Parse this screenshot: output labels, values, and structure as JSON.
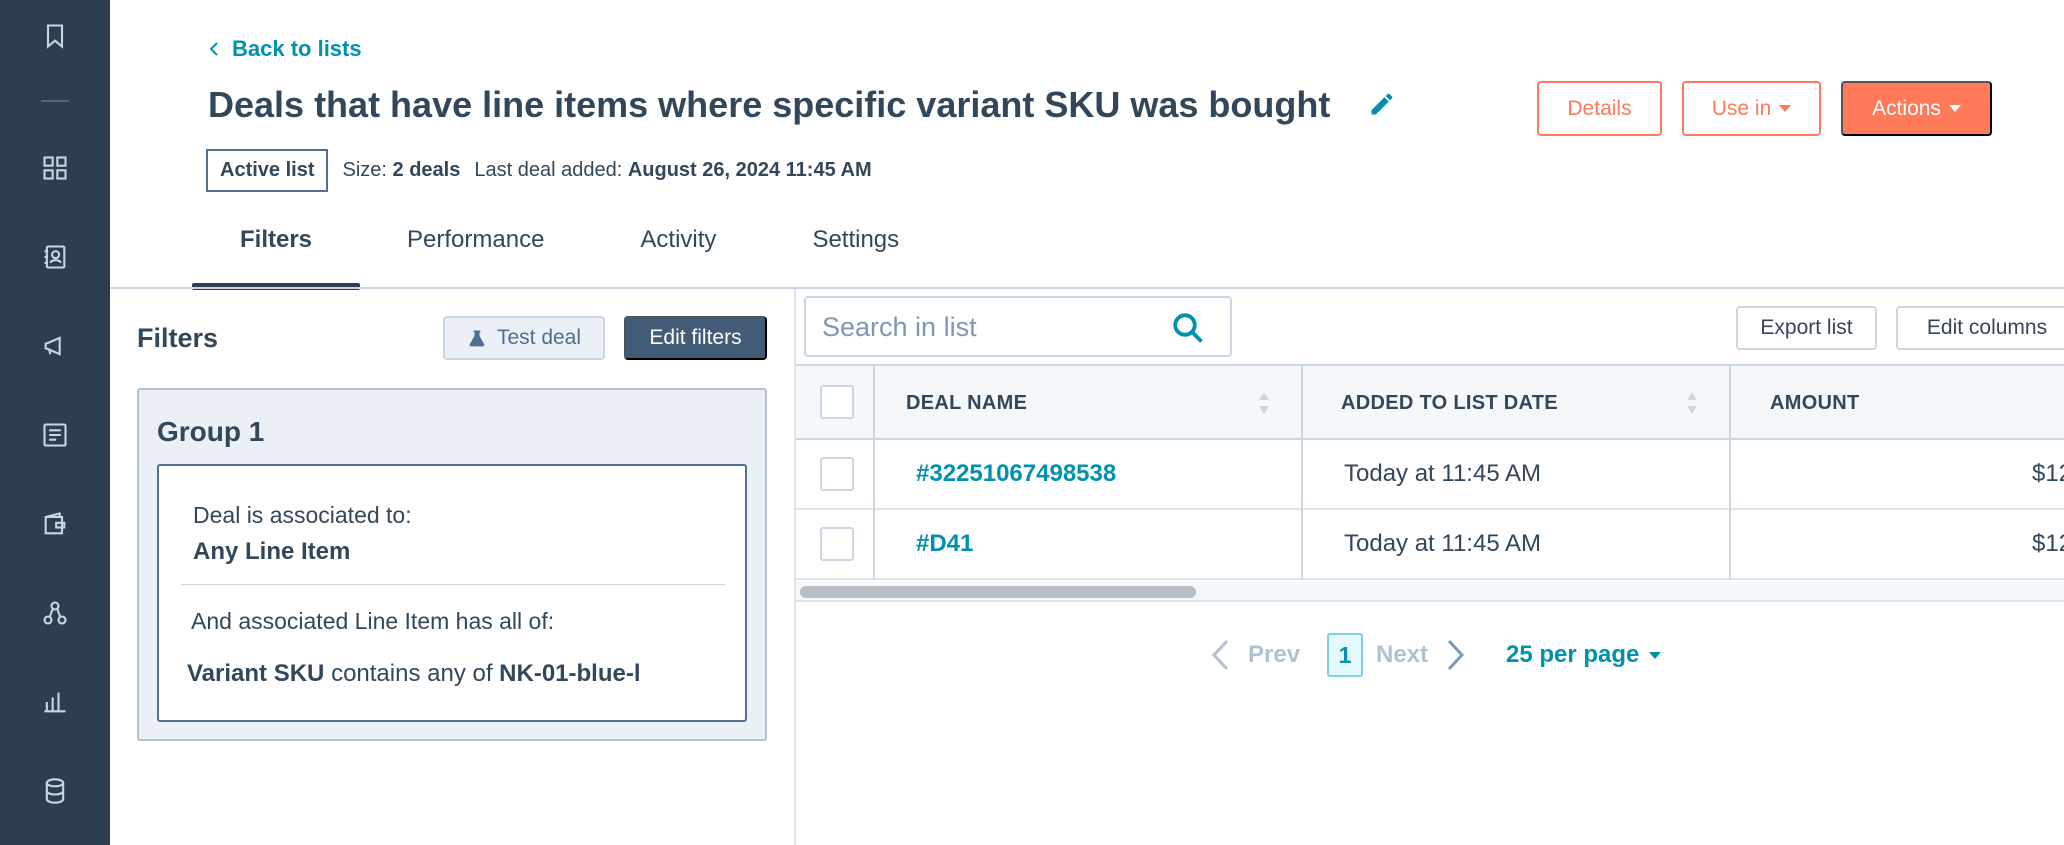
{
  "header": {
    "back_label": "Back to lists",
    "title": "Deals that have line items where specific variant SKU was bought",
    "details_label": "Details",
    "use_in_label": "Use in",
    "actions_label": "Actions",
    "active_tag": "Active list",
    "size_label": "Size:",
    "size_value": "2 deals",
    "last_added_label": "Last deal added:",
    "last_added_value": "August 26, 2024 11:45 AM"
  },
  "tabs": [
    {
      "label": "Filters",
      "active": true
    },
    {
      "label": "Performance",
      "active": false
    },
    {
      "label": "Activity",
      "active": false
    },
    {
      "label": "Settings",
      "active": false
    }
  ],
  "filters": {
    "title": "Filters",
    "test_label": "Test deal",
    "edit_label": "Edit filters",
    "group_title": "Group 1",
    "cond1_label": "Deal is associated to:",
    "cond1_value": "Any Line Item",
    "cond2_label": "And associated Line Item has all of:",
    "cond2_prop": "Variant SKU",
    "cond2_op": "contains any of",
    "cond2_value": "NK-01-blue-l"
  },
  "table": {
    "search_placeholder": "Search in list",
    "export_label": "Export list",
    "edit_columns_label": "Edit columns",
    "columns": [
      "DEAL NAME",
      "ADDED TO LIST DATE",
      "AMOUNT"
    ],
    "rows": [
      {
        "name": "#32251067498538",
        "added": "Today at 11:45 AM",
        "amount": "$12"
      },
      {
        "name": "#D41",
        "added": "Today at 11:45 AM",
        "amount": "$12"
      }
    ]
  },
  "pagination": {
    "prev_label": "Prev",
    "page": "1",
    "next_label": "Next",
    "per_page_label": "25 per page"
  },
  "colors": {
    "nav_bg": "#2d3e50",
    "accent_orange": "#ff7a59",
    "link_teal": "#0091ae",
    "text_dark": "#33475b"
  }
}
